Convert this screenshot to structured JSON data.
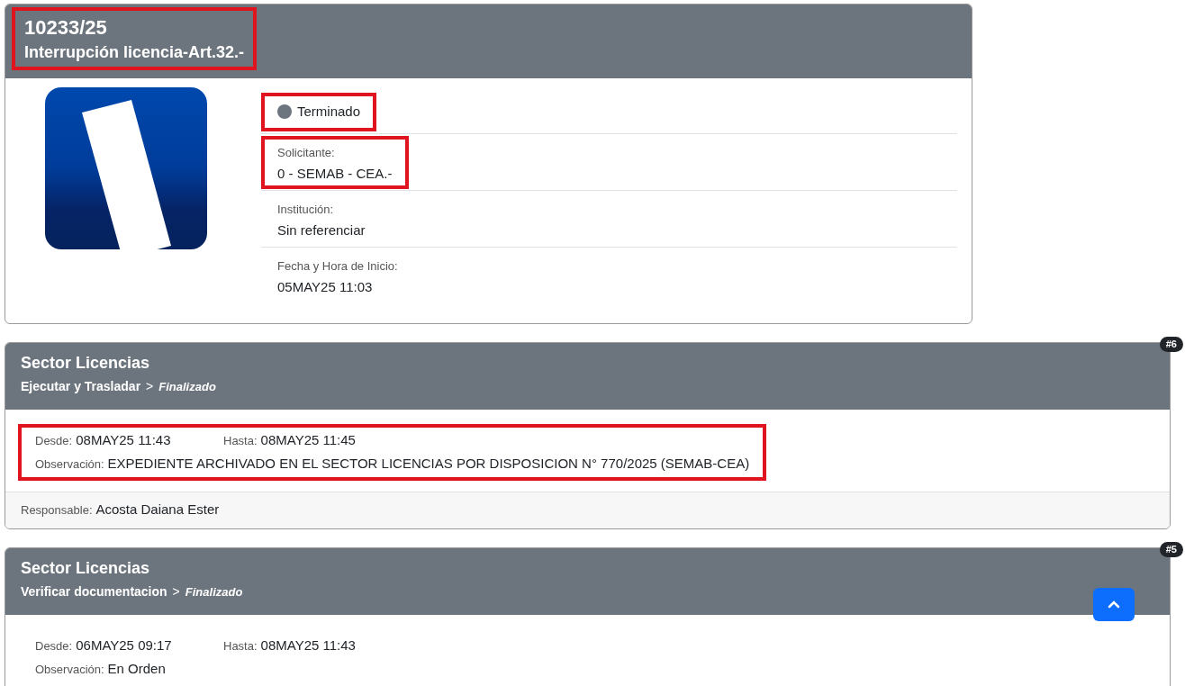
{
  "record": {
    "number": "10233/25",
    "title": "Interrupción licencia-Art.32.-",
    "highlighted": true,
    "status": {
      "label": "Terminado",
      "color": "#6c757d",
      "highlighted": true
    },
    "fields": [
      {
        "label": "Solicitante:",
        "value": "0 - SEMAB - CEA.-",
        "highlighted": true
      },
      {
        "label": "Institución:",
        "value": "Sin referenciar",
        "highlighted": false
      },
      {
        "label": "Fecha y Hora de Inicio:",
        "value": "05MAY25 11:03",
        "highlighted": false
      }
    ]
  },
  "steps": [
    {
      "badge": "#6",
      "sector": "Sector Licencias",
      "task": "Ejecutar y Trasladar",
      "separator": ">",
      "state": "Finalizado",
      "from_label": "Desde:",
      "from": "08MAY25 11:43",
      "to_label": "Hasta:",
      "to": "08MAY25 11:45",
      "note_label": "Observación:",
      "note": "EXPEDIENTE ARCHIVADO EN EL SECTOR LICENCIAS POR DISPOSICION N° 770/2025 (SEMAB-CEA)",
      "highlighted": true,
      "responsible_label": "Responsable:",
      "responsible": "Acosta Daiana Ester"
    },
    {
      "badge": "#5",
      "sector": "Sector Licencias",
      "task": "Verificar documentacion",
      "separator": ">",
      "state": "Finalizado",
      "from_label": "Desde:",
      "from": "06MAY25 09:17",
      "to_label": "Hasta:",
      "to": "08MAY25 11:43",
      "note_label": "Observación:",
      "note": "En Orden",
      "highlighted": false
    }
  ]
}
